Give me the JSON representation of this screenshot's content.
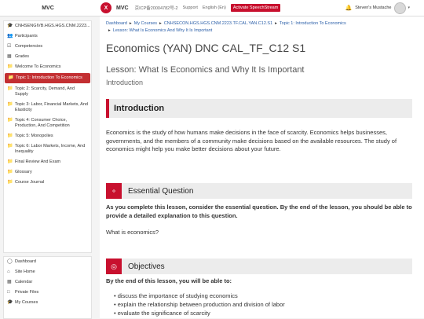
{
  "header": {
    "left_brand": "MVC",
    "logo_letter": "X",
    "right_brand": "MVC",
    "icp": "京ICP备20004782号-2",
    "support": "Support",
    "language": "English (En)",
    "speech_button": "Activate SpeechStream",
    "username": "Steven's Mustache"
  },
  "sidebar": {
    "items": [
      {
        "label": "CNHSENGIVB.HGS.HGS.CNM.2223...",
        "icon": "mortarboard-icon"
      },
      {
        "label": "Participants",
        "icon": "users-icon"
      },
      {
        "label": "Competencies",
        "icon": "checkbox-icon"
      },
      {
        "label": "Grades",
        "icon": "table-icon"
      },
      {
        "label": "Welcome To Economics",
        "icon": "folder-icon"
      },
      {
        "label": "Topic 1: Introduction To Economics",
        "icon": "folder-icon",
        "active": true
      },
      {
        "label": "Topic 2: Scarcity, Demand, And Supply",
        "icon": "folder-icon"
      },
      {
        "label": "Topic 3: Labor, Financial Markets, And Elasticity",
        "icon": "folder-icon"
      },
      {
        "label": "Topic 4: Consumer Choice, Production, And Competition",
        "icon": "folder-icon"
      },
      {
        "label": "Topic 5: Monopolies",
        "icon": "folder-icon"
      },
      {
        "label": "Topic 6: Labor Markets, Income, And Inequality",
        "icon": "folder-icon"
      },
      {
        "label": "Final Review And Exam",
        "icon": "folder-icon"
      },
      {
        "label": "Glossary",
        "icon": "folder-icon"
      },
      {
        "label": "Course Journal",
        "icon": "folder-icon"
      }
    ],
    "bottom": [
      {
        "label": "Dashboard",
        "icon": "dashboard-icon"
      },
      {
        "label": "Site Home",
        "icon": "home-icon"
      },
      {
        "label": "Calendar",
        "icon": "calendar-icon"
      },
      {
        "label": "Private Files",
        "icon": "file-icon"
      },
      {
        "label": "My Courses",
        "icon": "mortarboard-icon"
      }
    ]
  },
  "breadcrumb": {
    "items": [
      "Dashboard",
      "My Courses",
      "CNHSECON.HGS.HGS.CNM.2223.TF.CAL.YAN.C12.S1",
      "Topic 1: Introduction To Economics",
      "Lesson: What Is Economics And Why It Is Important"
    ]
  },
  "main": {
    "course_title": "Economics (YAN) DNC CAL_TF_C12 S1",
    "lesson_title": "Lesson: What Is Economics and Why It Is Important",
    "lesson_subtitle": "Introduction",
    "intro_heading": "Introduction",
    "intro_text": "Economics is the study of how humans make decisions in the face of scarcity. Economics helps businesses, governments, and the members of a community make decisions based on the available resources. The study of economics might help you make better decisions about your future.",
    "essential_heading": "Essential Question",
    "essential_text": "As you complete this lesson, consider the essential question. By the end of the lesson, you should be able to provide a detailed explanation to this question.",
    "question": "What is economics?",
    "objectives_heading": "Objectives",
    "objectives_intro": "By the end of this lesson, you will be able to:",
    "objectives": [
      "discuss the importance of studying economics",
      "explain the relationship between production and division of labor",
      "evaluate the significance of scarcity"
    ]
  },
  "colors": {
    "accent": "#c8102e",
    "link": "#2a5ea8"
  }
}
